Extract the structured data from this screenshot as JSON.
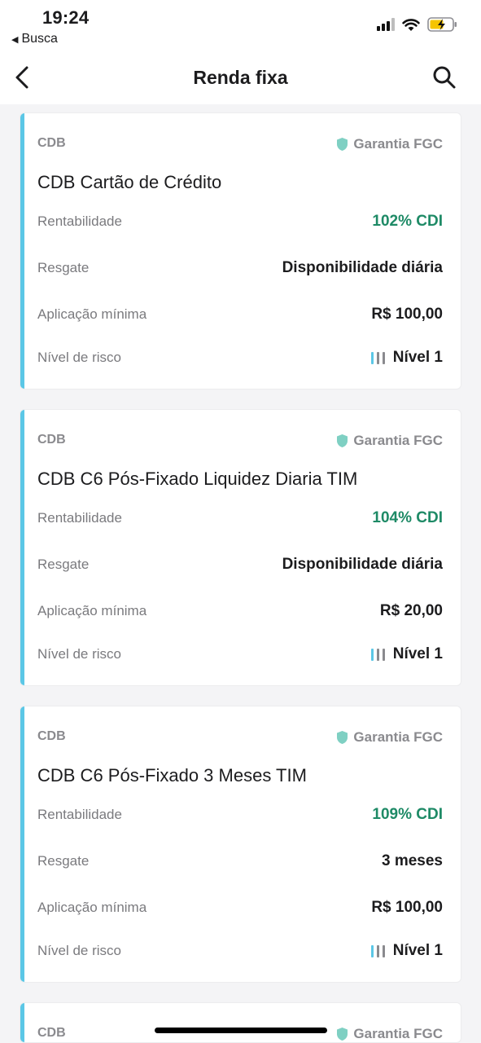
{
  "status_bar": {
    "time": "19:24",
    "back_app": "Busca"
  },
  "header": {
    "title": "Renda fixa"
  },
  "colors": {
    "accent": "#5bc7e6",
    "green": "#1e8a66",
    "shield": "#7fd0c3"
  },
  "cards": [
    {
      "category": "CDB",
      "guarantee": "Garantia FGC",
      "name": "CDB Cartão de Crédito",
      "rentabilidade_label": "Rentabilidade",
      "rentabilidade_value": "102% CDI",
      "resgate_label": "Resgate",
      "resgate_value": "Disponibilidade diária",
      "aplicacao_label": "Aplicação mínima",
      "aplicacao_value": "R$ 100,00",
      "risco_label": "Nível de risco",
      "risco_value": "Nível 1"
    },
    {
      "category": "CDB",
      "guarantee": "Garantia FGC",
      "name": "CDB C6 Pós-Fixado Liquidez Diaria TIM",
      "rentabilidade_label": "Rentabilidade",
      "rentabilidade_value": "104% CDI",
      "resgate_label": "Resgate",
      "resgate_value": "Disponibilidade diária",
      "aplicacao_label": "Aplicação mínima",
      "aplicacao_value": "R$ 20,00",
      "risco_label": "Nível de risco",
      "risco_value": "Nível 1"
    },
    {
      "category": "CDB",
      "guarantee": "Garantia FGC",
      "name": "CDB C6 Pós-Fixado 3 Meses TIM",
      "rentabilidade_label": "Rentabilidade",
      "rentabilidade_value": "109% CDI",
      "resgate_label": "Resgate",
      "resgate_value": "3 meses",
      "aplicacao_label": "Aplicação mínima",
      "aplicacao_value": "R$ 100,00",
      "risco_label": "Nível de risco",
      "risco_value": "Nível 1"
    },
    {
      "category": "CDB",
      "guarantee": "Garantia FGC"
    }
  ]
}
